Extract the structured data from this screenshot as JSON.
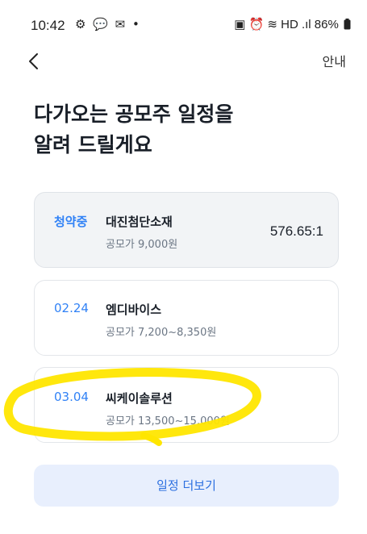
{
  "status_bar": {
    "time": "10:42",
    "left_icons": "⚙ 💬 ✉ •",
    "right_icons": "▣ ⏰ ≋ HD .ıl 86%",
    "battery_icon": "battery-icon"
  },
  "nav": {
    "back_icon": "chevron-left-icon",
    "guide_label": "안내"
  },
  "title": {
    "line1": "다가오는 공모주 일정을",
    "line2": "알려 드릴게요"
  },
  "ipos": [
    {
      "tag": "청약중",
      "name": "대진첨단소재",
      "price": "공모가 9,000원",
      "rate": "576.65:1"
    },
    {
      "tag": "02.24",
      "name": "엠디바이스",
      "price": "공모가 7,200~8,350원"
    },
    {
      "tag": "03.04",
      "name": "씨케이솔루션",
      "price": "공모가 13,500~15,000원"
    }
  ],
  "more_button": "일정 더보기",
  "colors": {
    "accent": "#3182f6",
    "highlight": "#ffe600",
    "button_bg": "#e8effd"
  }
}
